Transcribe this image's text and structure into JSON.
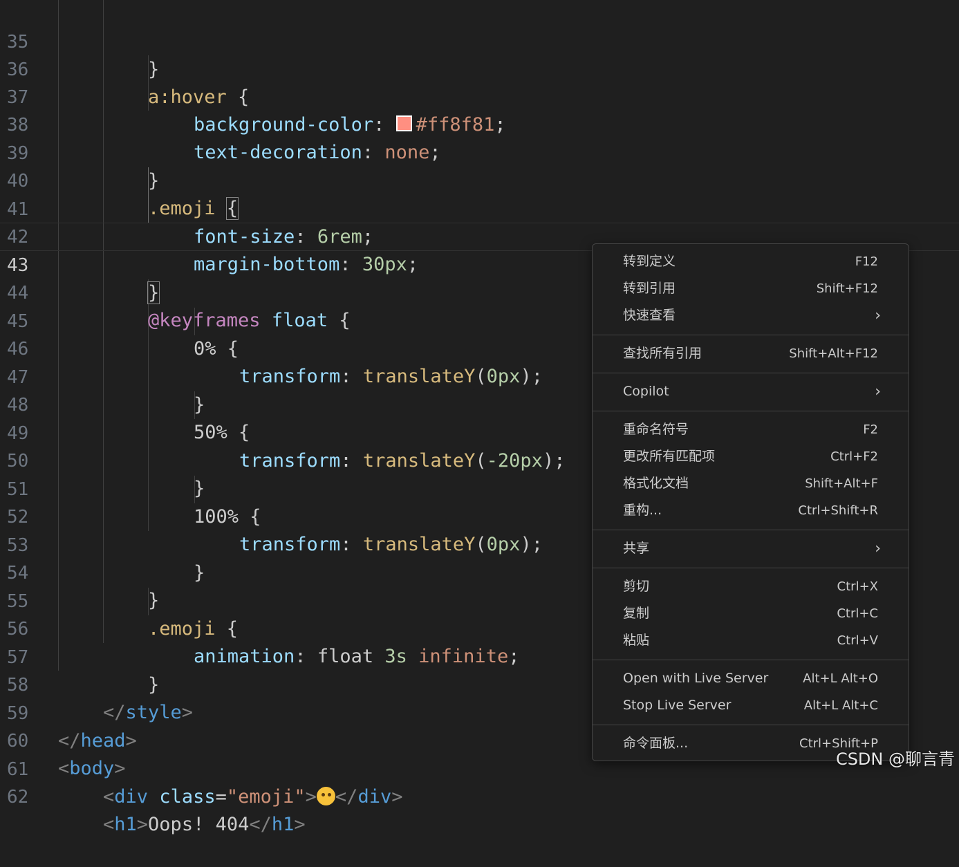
{
  "editor": {
    "line_numbers": [
      "35",
      "36",
      "37",
      "38",
      "39",
      "40",
      "41",
      "42",
      "43",
      "44",
      "45",
      "46",
      "47",
      "48",
      "49",
      "50",
      "51",
      "52",
      "53",
      "54",
      "55",
      "56",
      "57",
      "58",
      "59",
      "60",
      "61",
      "62"
    ],
    "lines": {
      "l35": {
        "p1": "}"
      },
      "l36": {
        "sel": "a:hover",
        "p1": " {"
      },
      "l37": {
        "prop": "background-color",
        "p1": ": ",
        "val": "#ff8f81",
        "p2": ";"
      },
      "l38": {
        "prop": "text-decoration",
        "p1": ": ",
        "val": "none",
        "p2": ";"
      },
      "l39": {
        "p1": "}"
      },
      "l40": {
        "sel": ".emoji",
        "p1": " ",
        "br": "{"
      },
      "l41": {
        "prop": "font-size",
        "p1": ": ",
        "num": "6rem",
        "p2": ";"
      },
      "l42": {
        "prop": "margin-bottom",
        "p1": ": ",
        "num": "30px",
        "p2": ";"
      },
      "l43": {
        "br": "}"
      },
      "l44": {
        "at": "@keyframes",
        "p1": " ",
        "name": "float",
        "p2": " {"
      },
      "l45": {
        "sel": "0%",
        "p1": " {"
      },
      "l46": {
        "prop": "transform",
        "p1": ": ",
        "fn": "translateY",
        "p2": "(",
        "num": "0px",
        "p3": ");"
      },
      "l47": {
        "p1": "}"
      },
      "l48": {
        "sel": "50%",
        "p1": " {"
      },
      "l49": {
        "prop": "transform",
        "p1": ": ",
        "fn": "translateY",
        "p2": "(",
        "num": "-20px",
        "p3": ");"
      },
      "l50": {
        "p1": "}"
      },
      "l51": {
        "sel": "100%",
        "p1": " {"
      },
      "l52": {
        "prop": "transform",
        "p1": ": ",
        "fn": "translateY",
        "p2": "(",
        "num": "0px",
        "p3": ");"
      },
      "l53": {
        "p1": "}"
      },
      "l54": {
        "p1": "}"
      },
      "l55": {
        "sel": ".emoji",
        "p1": " {"
      },
      "l56": {
        "prop": "animation",
        "p1": ": ",
        "name": "float",
        "p2": " ",
        "num": "3s",
        "p3": " ",
        "val": "infinite",
        "p4": ";"
      },
      "l57": {
        "p1": "}"
      },
      "l58": {
        "b1": "</",
        "tag": "style",
        "b2": ">"
      },
      "l59": {
        "b1": "</",
        "tag": "head",
        "b2": ">"
      },
      "l60": {
        "b1": "<",
        "tag": "body",
        "b2": ">"
      },
      "l61": {
        "b1": "<",
        "tag": "div",
        "sp": " ",
        "attr": "class",
        "eq": "=",
        "str": "\"emoji\"",
        "b2": ">",
        "emoji": "face-with-raised-eyebrow",
        "b3": "</",
        "tag2": "div",
        "b4": ">"
      },
      "l62": {
        "b1": "<",
        "tag": "h1",
        "b2": ">",
        "text": "Oops! 404",
        "b3": "</",
        "tag2": "h1",
        "b4": ">"
      }
    },
    "swatch_color": "#ff8f81"
  },
  "context_menu": {
    "items": [
      {
        "label": "转到定义",
        "shortcut": "F12"
      },
      {
        "label": "转到引用",
        "shortcut": "Shift+F12"
      },
      {
        "label": "快速查看",
        "submenu": "chevron-right-icon"
      },
      {
        "label": "查找所有引用",
        "shortcut": "Shift+Alt+F12"
      },
      {
        "label": "Copilot",
        "submenu": "chevron-right-icon"
      },
      {
        "label": "重命名符号",
        "shortcut": "F2"
      },
      {
        "label": "更改所有匹配项",
        "shortcut": "Ctrl+F2"
      },
      {
        "label": "格式化文档",
        "shortcut": "Shift+Alt+F"
      },
      {
        "label": "重构...",
        "shortcut": "Ctrl+Shift+R"
      },
      {
        "label": "共享",
        "submenu": "chevron-right-icon"
      },
      {
        "label": "剪切",
        "shortcut": "Ctrl+X"
      },
      {
        "label": "复制",
        "shortcut": "Ctrl+C"
      },
      {
        "label": "粘贴",
        "shortcut": "Ctrl+V"
      },
      {
        "label": "Open with Live Server",
        "shortcut": "Alt+L Alt+O"
      },
      {
        "label": "Stop Live Server",
        "shortcut": "Alt+L Alt+C"
      },
      {
        "label": "命令面板...",
        "shortcut": "Ctrl+Shift+P"
      }
    ],
    "chevron": "›"
  },
  "watermark": "CSDN @聊言青"
}
